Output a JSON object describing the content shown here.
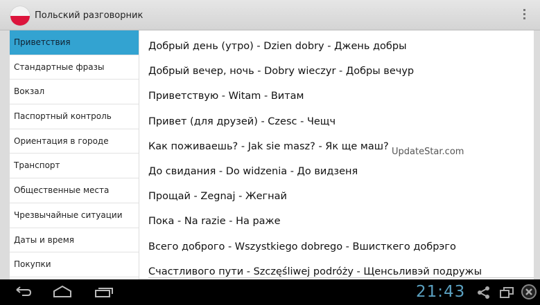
{
  "app": {
    "title": "Польский разговорник",
    "flag_colors": [
      "#f4f4f4",
      "#dc143c"
    ],
    "accent": "#33a3d1"
  },
  "sidebar": {
    "items": [
      {
        "label": "Приветствия",
        "active": true
      },
      {
        "label": "Стандартные фразы"
      },
      {
        "label": "Вокзал"
      },
      {
        "label": "Паспортный контроль"
      },
      {
        "label": "Ориентация в городе"
      },
      {
        "label": "Транспорт"
      },
      {
        "label": "Общественные места"
      },
      {
        "label": "Чрезвычайные ситуации"
      },
      {
        "label": "Даты и время"
      },
      {
        "label": "Покупки"
      }
    ]
  },
  "phrases": [
    "Добрый день (утро) - Dzien dobry - Джень добры",
    "Добрый вечер, ночь - Dobry wieczyr - Добры вечур",
    "Приветствую - Witam - Витам",
    "Привет (для друзей) - Czesc - Чещч",
    "Как поживаешь? - Jak sie masz? - Як ще маш?",
    "До свидания - Do widzenia - До видзеня",
    "Прощай - Zegnaj - Жегнай",
    "Пока - Na razie - На раже",
    "Всего доброго - Wszystkiego dobrego - Вшисткего добрэго",
    "Счастливого пути - Szczęśliwej podróży - Щенсьливэй подружы"
  ],
  "watermark": "UpdateStar.com",
  "statusbar": {
    "time": "21:43"
  }
}
